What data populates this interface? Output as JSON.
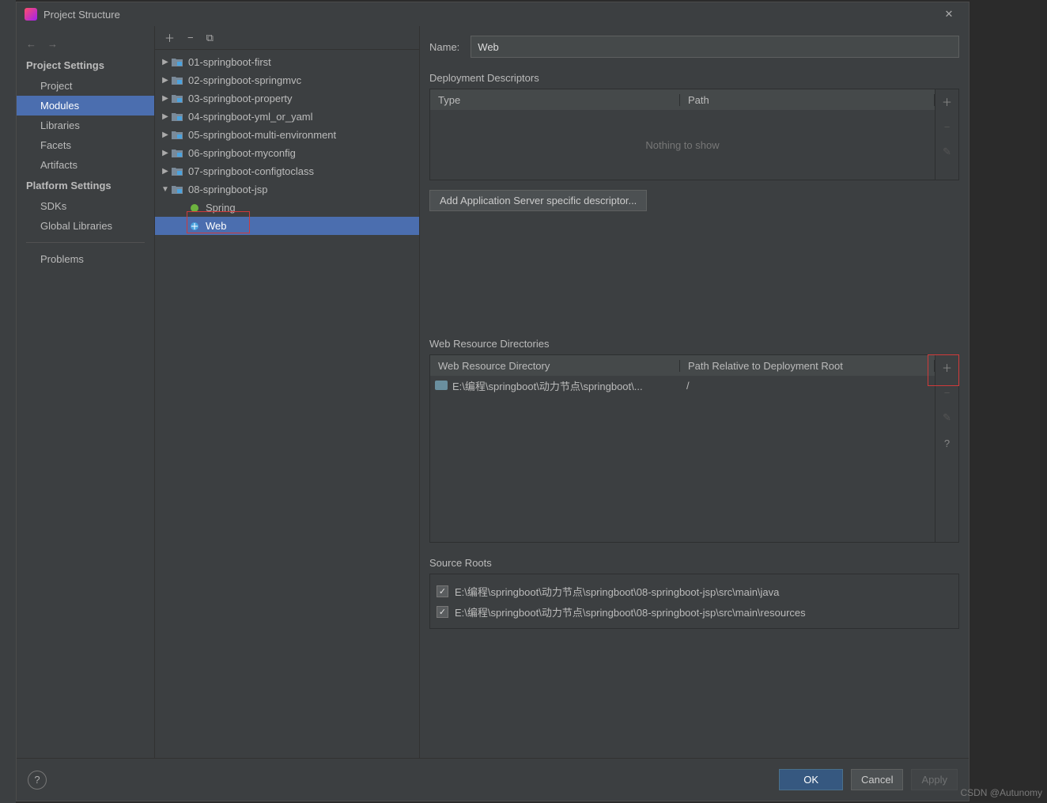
{
  "window": {
    "title": "Project Structure"
  },
  "sidebar": {
    "heading1": "Project Settings",
    "items1": [
      "Project",
      "Modules",
      "Libraries",
      "Facets",
      "Artifacts"
    ],
    "heading2": "Platform Settings",
    "items2": [
      "SDKs",
      "Global Libraries"
    ],
    "problems": "Problems"
  },
  "tree": {
    "nodes": [
      {
        "label": "01-springboot-first"
      },
      {
        "label": "02-springboot-springmvc"
      },
      {
        "label": "03-springboot-property"
      },
      {
        "label": "04-springboot-yml_or_yaml"
      },
      {
        "label": "05-springboot-multi-environment"
      },
      {
        "label": "06-springboot-myconfig"
      },
      {
        "label": "07-springboot-configtoclass"
      },
      {
        "label": "08-springboot-jsp"
      }
    ],
    "children": [
      "Spring",
      "Web"
    ]
  },
  "detail": {
    "name_label": "Name:",
    "name_value": "Web",
    "deploy_label": "Deployment Descriptors",
    "deploy_cols": [
      "Type",
      "Path"
    ],
    "nothing": "Nothing to show",
    "add_descriptor": "Add Application Server specific descriptor...",
    "wrd_label": "Web Resource Directories",
    "wrd_cols": [
      "Web Resource Directory",
      "Path Relative to Deployment Root"
    ],
    "wrd_row": {
      "dir": "E:\\编程\\springboot\\动力节点\\springboot\\...",
      "rel": "/"
    },
    "source_roots_label": "Source Roots",
    "source_roots": [
      "E:\\编程\\springboot\\动力节点\\springboot\\08-springboot-jsp\\src\\main\\java",
      "E:\\编程\\springboot\\动力节点\\springboot\\08-springboot-jsp\\src\\main\\resources"
    ]
  },
  "footer": {
    "ok": "OK",
    "cancel": "Cancel"
  },
  "watermark": "CSDN @Autunomy"
}
